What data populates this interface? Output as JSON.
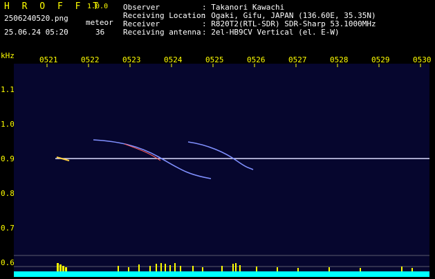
{
  "header": {
    "app_title": "H R O F F T",
    "version": "1.0.0",
    "filename": "2506240520.png",
    "detection_label": "meteor",
    "datetime": "25.06.24 05:20",
    "detection_count": "36",
    "info": [
      {
        "label": "Observer",
        "value": ": Takanori Kawachi"
      },
      {
        "label": "Receiving Location",
        "value": ": Ogaki, Gifu, JAPAN (136.60E, 35.35N)"
      },
      {
        "label": "Receiver",
        "value": ": R820T2(RTL-SDR) SDR-Sharp 53.1000MHz"
      },
      {
        "label": "Receiving antenna",
        "value": ": 2el-HB9CV Vertical (el. E-W)"
      }
    ]
  },
  "axis": {
    "unit": "kHz",
    "x_ticks": [
      "0521",
      "0522",
      "0523",
      "0524",
      "0525",
      "0526",
      "0527",
      "0528",
      "0529",
      "0530"
    ],
    "y_ticks": [
      "1.1",
      "1.0",
      "0.9",
      "0.8",
      "0.7",
      "0.6"
    ]
  },
  "colors": {
    "header_text": "#ffffff",
    "accent_text": "#ffff00",
    "background": "#06062e",
    "carrier": "#dcdcff",
    "meteor": "#8090ff",
    "level_bar": "#ffff00",
    "noise_floor": "#00ffff"
  }
}
